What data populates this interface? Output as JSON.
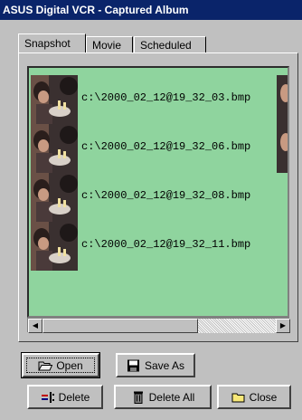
{
  "window": {
    "title": "ASUS Digital VCR - Captured Album"
  },
  "tabs": [
    {
      "label": "Snapshot",
      "active": true
    },
    {
      "label": "Movie",
      "active": false
    },
    {
      "label": "Scheduled",
      "active": false
    }
  ],
  "album": {
    "background_color": "#8fd49e",
    "items": [
      {
        "filename": "c:\\2000_02_12@19_32_03.bmp"
      },
      {
        "filename": "c:\\2000_02_12@19_32_06.bmp"
      },
      {
        "filename": "c:\\2000_02_12@19_32_08.bmp"
      },
      {
        "filename": "c:\\2000_02_12@19_32_11.bmp"
      }
    ]
  },
  "buttons": {
    "open": {
      "label": "Open",
      "icon": "folder-open-icon"
    },
    "save_as": {
      "label": "Save As",
      "icon": "floppy-disk-icon"
    },
    "delete": {
      "label": "Delete",
      "icon": "delete-icon"
    },
    "delete_all": {
      "label": "Delete All",
      "icon": "trash-can-icon"
    },
    "close": {
      "label": "Close",
      "icon": "folder-icon"
    }
  },
  "scrollbar": {
    "left_arrow": "◀",
    "right_arrow": "▶"
  }
}
